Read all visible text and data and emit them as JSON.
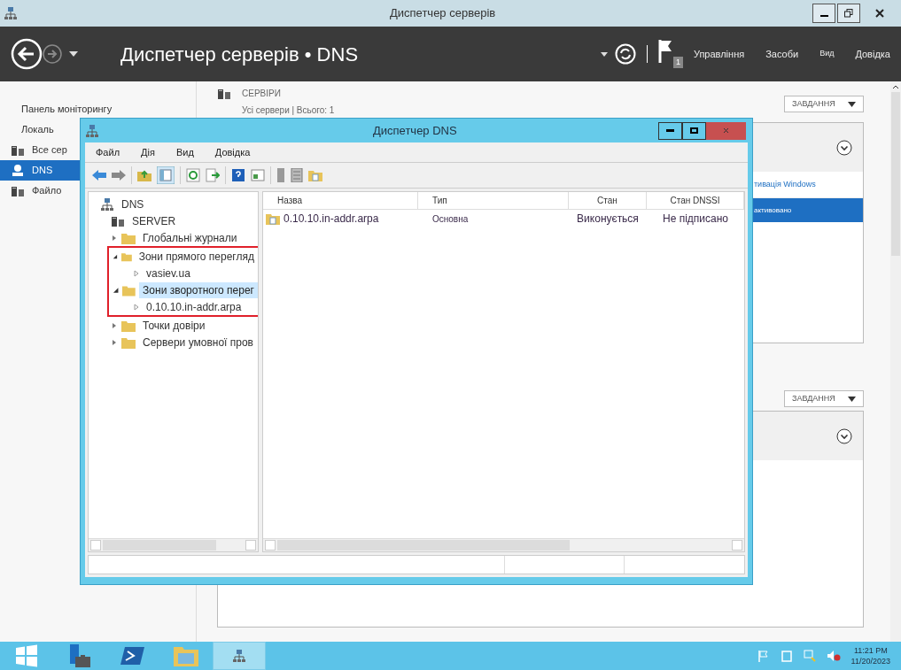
{
  "window": {
    "title": "Диспетчер серверів"
  },
  "header": {
    "title": "Диспетчер серверів • DNS",
    "flag_count": "1",
    "menu": [
      "Управління",
      "Засоби",
      "Вид",
      "Довідка"
    ]
  },
  "nav": [
    {
      "label": "Панель моніторингу",
      "kind": "text",
      "selected": false
    },
    {
      "label": "Локаль",
      "kind": "text",
      "selected": false
    },
    {
      "label": "Все сер",
      "kind": "servers",
      "selected": false
    },
    {
      "label": "DNS",
      "kind": "dns",
      "selected": true
    },
    {
      "label": "Файло",
      "kind": "files",
      "selected": false
    }
  ],
  "servers_tile": {
    "title": "СЕРВІРИ",
    "subtitle": "Усі сервери | Всього: 1",
    "tasks": "ЗАВДАННЯ",
    "column": "тивація Windows",
    "row": {
      "cell": "активовано",
      "selected": true
    }
  },
  "events_tile": {
    "tasks": "ЗАВДАННЯ"
  },
  "dns_window": {
    "title": "Диспетчер DNS",
    "menu": [
      "Файл",
      "Дія",
      "Вид",
      "Довідка"
    ],
    "tree": [
      {
        "label": "DNS",
        "kind": "dns",
        "selected": false,
        "children": [
          {
            "label": "SERVER",
            "kind": "server",
            "selected": false,
            "children": [
              {
                "label": "Глобальні журнали",
                "kind": "folder",
                "expanded": false,
                "selected": false
              },
              {
                "label": "Зони прямого перегляд",
                "kind": "folder",
                "expanded": true,
                "selected": false,
                "marked": true,
                "children": [
                  {
                    "label": "vasiev.ua",
                    "kind": "zone",
                    "selected": false
                  }
                ]
              },
              {
                "label": "Зони зворотного перег",
                "kind": "folder",
                "expanded": true,
                "selected": true,
                "marked": true,
                "children": [
                  {
                    "label": "0.10.10.in-addr.arpa",
                    "kind": "zone",
                    "selected": false
                  }
                ]
              },
              {
                "label": "Точки довіри",
                "kind": "folder",
                "expanded": false,
                "selected": false
              },
              {
                "label": "Сервери умовної пров",
                "kind": "folder",
                "expanded": false,
                "selected": false
              }
            ]
          }
        ]
      }
    ],
    "columns": [
      "Назва",
      "Тип",
      "Стан",
      "Стан DNSSI"
    ],
    "rows": [
      {
        "cells": [
          "0.10.10.in-addr.arpa",
          "Основна",
          "Виконується",
          "Не підписано"
        ]
      }
    ]
  },
  "taskbar": {
    "apps": [
      {
        "kind": "start",
        "selected": false
      },
      {
        "kind": "server-manager",
        "selected": false
      },
      {
        "kind": "powershell",
        "selected": false
      },
      {
        "kind": "explorer",
        "selected": false
      },
      {
        "kind": "dns",
        "selected": true
      }
    ],
    "time": "11:21 PM",
    "date": "11/20/2023"
  }
}
